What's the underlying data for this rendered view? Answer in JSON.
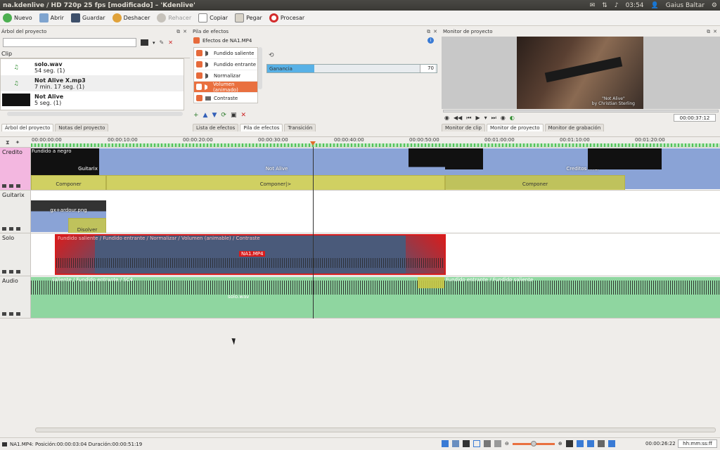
{
  "window": {
    "title": "na.kdenlive / HD 720p 25 fps [modificado] – 'Kdenlive'"
  },
  "tray": {
    "time": "03:54",
    "user": "Gaius Baltar"
  },
  "toolbar": {
    "nuevo": "Nuevo",
    "abrir": "Abrir",
    "guardar": "Guardar",
    "deshacer": "Deshacer",
    "rehacer": "Rehacer",
    "copiar": "Copiar",
    "pegar": "Pegar",
    "procesar": "Procesar"
  },
  "project_tree": {
    "title": "Árbol del proyecto",
    "search_placeholder": "",
    "column": "Clip",
    "items": [
      {
        "name": "solo.wav",
        "info": "54 seg. (1)"
      },
      {
        "name": "Not Alive X.mp3",
        "info": "7 min. 17 seg. (1)"
      },
      {
        "name": "Not Alive",
        "info": "5 seg. (1)"
      }
    ],
    "tabs": [
      "Árbol del proyecto",
      "Notas del proyecto"
    ]
  },
  "effects": {
    "title": "Pila de efectos",
    "header": "Efectos de NA1.MP4",
    "items": [
      "Fundido saliente",
      "Fundido entrante",
      "Normalizar",
      "Volumen (animado)",
      "Contraste"
    ],
    "selected_index": 3,
    "param_label": "Ganancia",
    "param_value": "70",
    "param_fraction": 0.28,
    "tabs": [
      "Lista de efectos",
      "Pila de efectos",
      "Transición"
    ]
  },
  "monitor": {
    "title": "Monitor de proyecto",
    "caption1": "\"Not Alive\"",
    "caption2": "by Christian Sterling",
    "timecode": "00:00:37:12",
    "tabs": [
      "Monitor de clip",
      "Monitor de proyecto",
      "Monitor de grabación"
    ]
  },
  "ruler": {
    "labels": [
      "00:00:00:00",
      "00:00:10:00",
      "00:00:20:00",
      "00:00:30:00",
      "00:00:40:00",
      "00:00:50:00",
      "00:01:00:00",
      "00:01:10:00",
      "00:01:20:00"
    ]
  },
  "tracks": {
    "credito": {
      "name": "Credito",
      "clips": [
        "Fundido a negro",
        "Guitarix",
        "Not Alive",
        "Creditos final"
      ],
      "transitions": [
        "Componer",
        "Componer|>",
        "Componer"
      ]
    },
    "guitarix": {
      "name": "Guitarix",
      "clips": [
        "gx+ardour.png"
      ],
      "transitions": [
        "Disolver"
      ]
    },
    "solo": {
      "name": "Solo",
      "clip_label": "NA1.MP4",
      "effects_label": "Fundido saliente / Fundido entrante / Normalizar / Volumen (animable) / Contraste"
    },
    "audio": {
      "name": "Audio",
      "clip_label": "solo.wav",
      "effects_left": "saliente / Fundido entrante / SC4",
      "effects_right": "Fundido entrante / Fundido saliente"
    }
  },
  "status": {
    "text": "NA1.MP4: Posición:00:00:03:04 Duración:00:00:51:19",
    "timecode": "00:00:26:22",
    "format": "hh:mm:ss:ff"
  },
  "colors": {
    "video_clip": "#8aa3d6",
    "transition": "#c8c646",
    "solo_border": "#d81c1c",
    "audio_clip": "#8fd6a0",
    "accent": "#e9703f"
  }
}
